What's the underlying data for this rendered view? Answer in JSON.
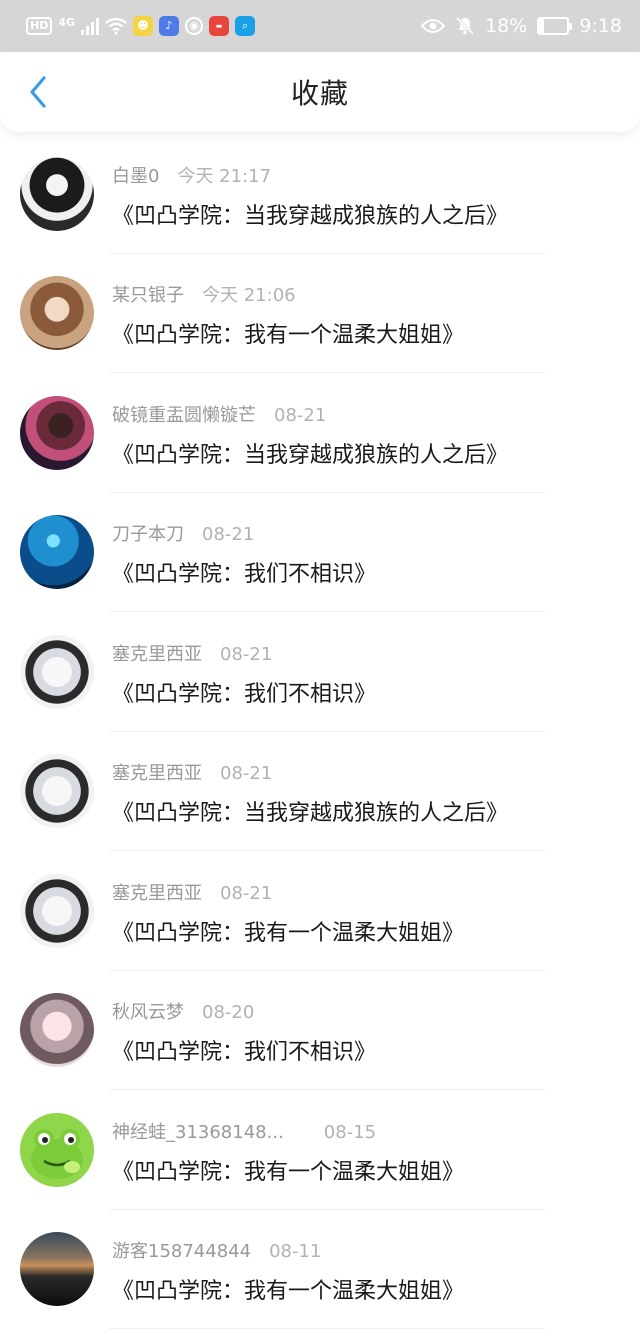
{
  "status_bar": {
    "hd": "HD",
    "net": "4G",
    "battery": "18%",
    "time": "9:18"
  },
  "header": {
    "title": "收藏"
  },
  "items": [
    {
      "name": "白墨0",
      "time": "今天 21:17",
      "title": "《凹凸学院：当我穿越成狼族的人之后》",
      "avatar": "avatar-white-black"
    },
    {
      "name": "某只银子",
      "time": "今天 21:06",
      "title": "《凹凸学院：我有一个温柔大姐姐》",
      "avatar": "avatar-brown"
    },
    {
      "name": "破镜重盂圆懒镟芒",
      "time": "08-21",
      "title": "《凹凸学院：当我穿越成狼族的人之后》",
      "avatar": "avatar-night"
    },
    {
      "name": "刀子本刀",
      "time": "08-21",
      "title": "《凹凸学院：我们不相识》",
      "avatar": "avatar-blue"
    },
    {
      "name": "塞克里西亚",
      "time": "08-21",
      "title": "《凹凸学院：我们不相识》",
      "avatar": "avatar-anime"
    },
    {
      "name": "塞克里西亚",
      "time": "08-21",
      "title": "《凹凸学院：当我穿越成狼族的人之后》",
      "avatar": "avatar-anime"
    },
    {
      "name": "塞克里西亚",
      "time": "08-21",
      "title": "《凹凸学院：我有一个温柔大姐姐》",
      "avatar": "avatar-anime"
    },
    {
      "name": "秋风云梦",
      "time": "08-20",
      "title": "《凹凸学院：我们不相识》",
      "avatar": "avatar-pink"
    },
    {
      "name": "神经蛙_31368148...",
      "time": "08-15",
      "title": "《凹凸学院：我有一个温柔大姐姐》",
      "avatar": "avatar-frog"
    },
    {
      "name": "游客158744844",
      "time": "08-11",
      "title": "《凹凸学院：我有一个温柔大姐姐》",
      "avatar": "avatar-dusk"
    }
  ],
  "colors": {
    "accent": "#3a9be8",
    "status_bar_bg": "#d6d6d6",
    "name_text": "#999999",
    "title_text": "#1a1a1a"
  }
}
